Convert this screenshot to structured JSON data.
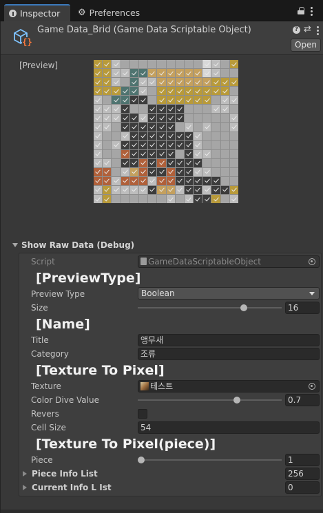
{
  "tabs": [
    {
      "label": "Inspector",
      "icon": "info-icon"
    },
    {
      "label": "Preferences",
      "icon": "gear-icon"
    }
  ],
  "header": {
    "title": "Game Data_Brid (Game Data Scriptable Object)",
    "open_label": "Open"
  },
  "preview": {
    "label": "[Preview]",
    "grid_size": 16,
    "cells": [
      "yyg.........sg.ygg",
      "yyggbbwwwwwwsg..",
      "yyg.bggwwwwwwyyy",
      "yyytbg.yyyyyyyy.",
      "g.ttdd.yyyyyy.gg",
      "gggd..dddd...gg.",
      "gggddgdddd.....g",
      "gg.dddddd.g.g..g",
      "g..gdddddddg....",
      "g.gddddddddg....",
      "g..oddddd.dgg...",
      "gg.ddododddd....",
      "oo.gwoddoddgg...",
      "oogooogooddddd..",
      "gyggggdwwgddgddy",
      "gy......g.gddy.g"
    ]
  },
  "raw": {
    "foldout_label": "Show Raw Data (Debug)",
    "script_label": "Script",
    "script_value": "GameDataScriptableObject",
    "h_preview_type": "[PreviewType]",
    "preview_type_label": "Preview Type",
    "preview_type_value": "Boolean",
    "size_label": "Size",
    "size_value": "16",
    "size_fraction": 0.75,
    "h_name": "[Name]",
    "title_label": "Title",
    "title_value": "앵무새",
    "category_label": "Category",
    "category_value": "조류",
    "h_texture": "[Texture To Pixel]",
    "texture_label": "Texture",
    "texture_value": "테스트",
    "color_dive_label": "Color Dive Value",
    "color_dive_value": "0.7",
    "color_dive_fraction": 0.7,
    "revers_label": "Revers",
    "revers_checked": false,
    "cell_size_label": "Cell Size",
    "cell_size_value": "54",
    "h_piece": "[Texture To Pixel(piece)]",
    "piece_label": "Piece",
    "piece_value": "1",
    "piece_fraction": 0.0,
    "piece_info_label": "Piece Info List",
    "piece_info_value": "256",
    "current_info_label": "Current Info L Ist",
    "current_info_value": "0"
  },
  "colors": {
    "accent": "#3a79bb",
    "cell_gray": "#a6a6a6",
    "cell_light": "#bdbdbd",
    "cell_dark": "#3c3c3c",
    "cell_yellow": "#b89a3a",
    "cell_green": "#5c7a2e",
    "cell_orange": "#b0603a",
    "cell_teal": "#4f7470",
    "cell_tan": "#c4a05e",
    "cell_white": "#d8d8d8"
  }
}
